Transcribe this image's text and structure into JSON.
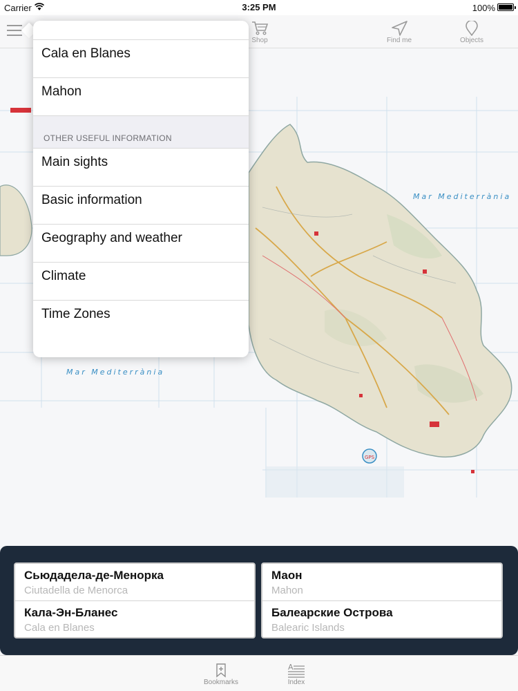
{
  "status_bar": {
    "carrier": "Carrier",
    "time": "3:25 PM",
    "battery": "100%",
    "battery_level": 1.0
  },
  "toolbar": {
    "menu_icon": "hamburger-icon",
    "shop": {
      "label": "Shop",
      "icon": "cart-icon"
    },
    "find_me": {
      "label": "Find me",
      "icon": "location-arrow-icon"
    },
    "objects": {
      "label": "Objects",
      "icon": "map-pin-icon"
    }
  },
  "map": {
    "labels": [
      "Mar Mediterrània",
      "Mar Mediterrània"
    ],
    "colors": {
      "sea": "#f6f7f9",
      "land": "#e6e2cf",
      "coast": "#8ea7a2",
      "roads": "#d8a84a",
      "water_label": "#3a8fc4"
    }
  },
  "menu": {
    "items_top": [
      "Cala en Blanes",
      "Mahon"
    ],
    "section_header": "OTHER USEFUL INFORMATION",
    "items_info": [
      "Main sights",
      "Basic information",
      "Geography and weather",
      "Climate",
      "Time Zones"
    ]
  },
  "places": {
    "left": [
      {
        "name": "Сьюдадела-де-Менорка",
        "latin": "Ciutadella de Menorca"
      },
      {
        "name": "Кала-Эн-Бланес",
        "latin": "Cala en Blanes"
      }
    ],
    "right": [
      {
        "name": "Маон",
        "latin": "Mahon"
      },
      {
        "name": "Балеарские Острова",
        "latin": "Balearic Islands"
      }
    ]
  },
  "tab_bar": {
    "bookmarks": {
      "label": "Bookmarks",
      "icon": "bookmark-add-icon"
    },
    "index": {
      "label": "Index",
      "icon": "index-list-icon"
    }
  }
}
